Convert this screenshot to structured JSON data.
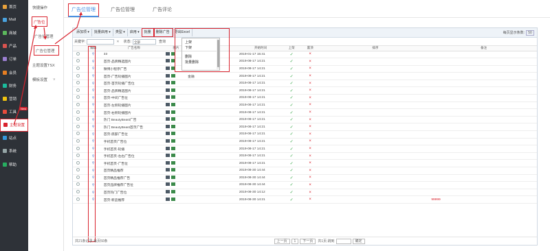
{
  "left_nav": [
    {
      "label": "首页",
      "active": false,
      "badge": ""
    },
    {
      "label": "Mall",
      "active": false,
      "badge": ""
    },
    {
      "label": "商城",
      "active": false,
      "badge": ""
    },
    {
      "label": "产品",
      "active": false,
      "badge": ""
    },
    {
      "label": "订单",
      "active": false,
      "badge": ""
    },
    {
      "label": "会员",
      "active": false,
      "badge": ""
    },
    {
      "label": "财务",
      "active": false,
      "badge": ""
    },
    {
      "label": "营销",
      "active": false,
      "badge": ""
    },
    {
      "label": "工具",
      "active": false,
      "badge": "New"
    },
    {
      "label": "主题设置",
      "active": true,
      "badge": ""
    },
    {
      "label": "站点",
      "active": false,
      "badge": ""
    },
    {
      "label": "系统",
      "active": false,
      "badge": ""
    },
    {
      "label": "帮助",
      "active": false,
      "badge": ""
    }
  ],
  "sub_nav": [
    {
      "label": "快捷操作",
      "boxed": false,
      "sub": false,
      "caret": ""
    },
    {
      "label": "广告位",
      "boxed": true,
      "sub": false,
      "caret": "^"
    },
    {
      "label": "广告位管理",
      "boxed": false,
      "sub": true,
      "caret": ""
    },
    {
      "label": "广告位管理",
      "boxed": true,
      "sub": true,
      "caret": ""
    },
    {
      "label": "主题设置TSX",
      "boxed": false,
      "sub": false,
      "caret": ""
    },
    {
      "label": "模板设置",
      "boxed": false,
      "sub": false,
      "caret": "v"
    }
  ],
  "tabs": [
    {
      "label": "广告位管理",
      "active": true
    },
    {
      "label": "广告位管理",
      "active": false
    },
    {
      "label": "广告评论",
      "active": false
    }
  ],
  "toolbar": {
    "buttons": [
      {
        "label": "添加项 ▾",
        "boxed": false
      },
      {
        "label": "批量启用 ▾",
        "boxed": false
      },
      {
        "label": "类型 ▾",
        "boxed": false
      },
      {
        "label": "启用 ▾",
        "boxed": false
      },
      {
        "label": "批量",
        "boxed": true
      },
      {
        "label": "删除广告",
        "boxed": true
      },
      {
        "label": "导出Excel",
        "boxed": false
      }
    ],
    "page_size_label": "每页显示条数:",
    "page_size_value": "50"
  },
  "search": {
    "keyword_label": "关键字:",
    "status_label": "状态:",
    "status_value": "全部",
    "search_button": "查询"
  },
  "dropdown": {
    "items": [
      "上架",
      "下架",
      "",
      "删除",
      "批量删除"
    ]
  },
  "table": {
    "headers": [
      "",
      "编辑",
      "广告名称",
      "图片",
      "类型",
      "开始时间",
      "上架",
      "置顶",
      "排序",
      "备注"
    ],
    "rows": [
      {
        "name": "33",
        "type": "",
        "time": "2019-01-17 15:41",
        "on": "✓",
        "top": "×",
        "note": ""
      },
      {
        "name": "首页-品牌精选图片",
        "type": "",
        "time": "2019-08-17 14:21",
        "on": "✓",
        "top": "×",
        "note": ""
      },
      {
        "name": "微博小程序广告",
        "type": "",
        "time": "2019-08-17 14:21",
        "on": "✓",
        "top": "×",
        "note": ""
      },
      {
        "name": "首页-广告轮播图片",
        "type": "金融",
        "time": "2019-08-17 14:21",
        "on": "✓",
        "top": "×",
        "note": ""
      },
      {
        "name": "首页-首页轮播广告位",
        "type": "",
        "time": "2019-08-17 14:21",
        "on": "✓",
        "top": "×",
        "note": ""
      },
      {
        "name": "首页-品牌精选图片",
        "type": "",
        "time": "2019-08-17 14:21",
        "on": "✓",
        "top": "×",
        "note": ""
      },
      {
        "name": "首页-中间广告位",
        "type": "",
        "time": "2019-08-17 14:21",
        "on": "✓",
        "top": "×",
        "note": ""
      },
      {
        "name": "首页-左侧轮播图片",
        "type": "",
        "time": "2019-08-17 14:21",
        "on": "✓",
        "top": "×",
        "note": ""
      },
      {
        "name": "首页-右侧轮播图片",
        "type": "",
        "time": "2019-08-17 14:21",
        "on": "✓",
        "top": "×",
        "note": ""
      },
      {
        "name": "热门 BeautyBeast广告",
        "type": "",
        "time": "2019-08-17 14:21",
        "on": "✓",
        "top": "×",
        "note": ""
      },
      {
        "name": "热门 BeautyBeast首页广告",
        "type": "",
        "time": "2019-08-17 14:21",
        "on": "✓",
        "top": "×",
        "note": ""
      },
      {
        "name": "首页-底部广告位",
        "type": "",
        "time": "2019-08-17 14:21",
        "on": "✓",
        "top": "×",
        "note": ""
      },
      {
        "name": "手机首页广告位",
        "type": "",
        "time": "2019-08-17 14:21",
        "on": "✓",
        "top": "×",
        "note": ""
      },
      {
        "name": "手机首页-轮播",
        "type": "",
        "time": "2019-08-17 14:21",
        "on": "✓",
        "top": "×",
        "note": ""
      },
      {
        "name": "手机首页-左右广告位",
        "type": "",
        "time": "2019-08-17 14:21",
        "on": "✓",
        "top": "×",
        "note": ""
      },
      {
        "name": "手机首页-广告位",
        "type": "",
        "time": "2019-08-17 14:21",
        "on": "✓",
        "top": "×",
        "note": ""
      },
      {
        "name": "首页精品推荐",
        "type": "",
        "time": "2019-08-30 14:44",
        "on": "✓",
        "top": "×",
        "note": ""
      },
      {
        "name": "首页精品推荐广告",
        "type": "",
        "time": "2019-08-30 14:44",
        "on": "✓",
        "top": "×",
        "note": ""
      },
      {
        "name": "首页品牌推荐广告位",
        "type": "",
        "time": "2019-08-30 14:44",
        "on": "✓",
        "top": "×",
        "note": ""
      },
      {
        "name": "首页热门广告位",
        "type": "",
        "time": "2019-08-30 14:12",
        "on": "✓",
        "top": "×",
        "note": ""
      },
      {
        "name": "首页-新品推荐",
        "type": "",
        "time": "2019-08-30 14:21",
        "on": "✓",
        "top": "×",
        "note": "99999"
      }
    ]
  },
  "pager": {
    "summary": "共21条记录 每页50条",
    "prev": "上一页",
    "page": "1",
    "next": "下一页",
    "total": "共1页 跳到",
    "go": "确定"
  },
  "colors": {
    "accent": "#4a90e2",
    "highlight": "#d9232e",
    "nav_bg": "#2e3238"
  }
}
